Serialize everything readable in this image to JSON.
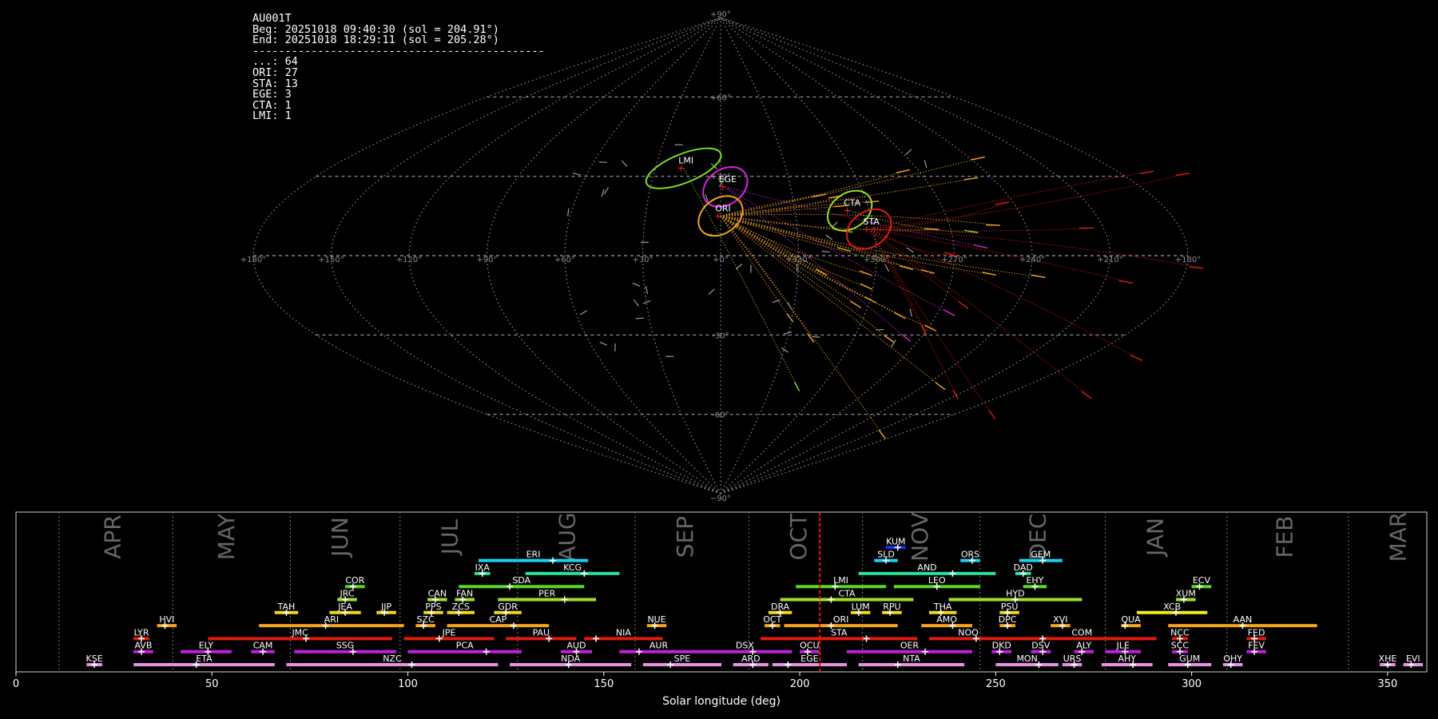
{
  "info": {
    "station": "AU001T",
    "beg": "Beg: 20251018 09:40:30 (sol = 204.91°)",
    "end": "End: 20251018 18:29:11 (sol = 205.28°)",
    "separator": "---------------------------------------------",
    "counts": [
      {
        "code": "...",
        "n": 64
      },
      {
        "code": "ORI",
        "n": 27
      },
      {
        "code": "STA",
        "n": 13
      },
      {
        "code": "EGE",
        "n": 3
      },
      {
        "code": "CTA",
        "n": 1
      },
      {
        "code": "LMI",
        "n": 1
      }
    ]
  },
  "chart_data": [
    {
      "type": "scatter",
      "title": "",
      "projection": "sinusoidal all-sky",
      "lon_ticks": [
        "+180°",
        "+150°",
        "+120°",
        "+90°",
        "+60°",
        "+30°",
        "+0°",
        "+330°",
        "+300°",
        "+270°",
        "+240°",
        "+210°",
        "+180°"
      ],
      "lat_ticks": [
        "+90°",
        "+60°",
        "+30°",
        "-30°",
        "-60°",
        "−90°"
      ],
      "grid": true,
      "radiants": [
        {
          "code": "LMI",
          "lon": 107,
          "lat": 33,
          "color": "#7cd922",
          "count": 1
        },
        {
          "code": "EGE",
          "lon": 88,
          "lat": 26,
          "color": "#dd22dd",
          "count": 3
        },
        {
          "code": "ORI",
          "lon": 90,
          "lat": 15,
          "color": "#f2a318",
          "count": 27
        },
        {
          "code": "CTA",
          "lon": 38,
          "lat": 17,
          "color": "#9ce022",
          "count": 1
        },
        {
          "code": "STA",
          "lon": 32,
          "lat": 10,
          "color": "#e01a0e",
          "count": 13
        }
      ]
    },
    {
      "type": "timeline",
      "xlabel": "Solar longitude (deg)",
      "xlim": [
        0,
        360
      ],
      "xticks": [
        "0",
        "50",
        "100",
        "150",
        "200",
        "250",
        "300",
        "350"
      ],
      "current_sol": 205.1,
      "months": [
        {
          "label": "APR",
          "sol": 25
        },
        {
          "label": "MAY",
          "sol": 54
        },
        {
          "label": "JUN",
          "sol": 83
        },
        {
          "label": "JUL",
          "sol": 111
        },
        {
          "label": "AUG",
          "sol": 141
        },
        {
          "label": "SEP",
          "sol": 171
        },
        {
          "label": "OCT",
          "sol": 200
        },
        {
          "label": "NOV",
          "sol": 231
        },
        {
          "label": "DEC",
          "sol": 261
        },
        {
          "label": "JAN",
          "sol": 291
        },
        {
          "label": "FEB",
          "sol": 324
        },
        {
          "label": "MAR",
          "sol": 353
        }
      ],
      "month_dividers": [
        11,
        40,
        70,
        98,
        128,
        158,
        187,
        216,
        246,
        278,
        309,
        340
      ],
      "showers": [
        {
          "code": "KUM",
          "row": 9,
          "start": 222,
          "end": 227,
          "peak": 225,
          "color": "#2030e8"
        },
        {
          "code": "ERI",
          "row": 8,
          "start": 118,
          "end": 146,
          "peak": 137,
          "color": "#18d0f0"
        },
        {
          "code": "SLD",
          "row": 8,
          "start": 219,
          "end": 225,
          "peak": 222,
          "color": "#18d0f0"
        },
        {
          "code": "ORS",
          "row": 8,
          "start": 241,
          "end": 246,
          "peak": 244,
          "color": "#18d0f0"
        },
        {
          "code": "GEM",
          "row": 8,
          "start": 256,
          "end": 267,
          "peak": 262,
          "color": "#18d0f0"
        },
        {
          "code": "IXA",
          "row": 7,
          "start": 117,
          "end": 121,
          "peak": 119,
          "color": "#28e09a"
        },
        {
          "code": "KCG",
          "row": 7,
          "start": 130,
          "end": 154,
          "peak": 145,
          "color": "#28e09a"
        },
        {
          "code": "AND",
          "row": 7,
          "start": 215,
          "end": 250,
          "peak": 239,
          "color": "#28e09a"
        },
        {
          "code": "DAD",
          "row": 7,
          "start": 255,
          "end": 259,
          "peak": 257,
          "color": "#28e09a"
        },
        {
          "code": "COR",
          "row": 6,
          "start": 84,
          "end": 89,
          "peak": 86,
          "color": "#58d820"
        },
        {
          "code": "SDA",
          "row": 6,
          "start": 113,
          "end": 145,
          "peak": 126,
          "color": "#58d820"
        },
        {
          "code": "LMI",
          "row": 6,
          "start": 199,
          "end": 222,
          "peak": 209,
          "color": "#58d820"
        },
        {
          "code": "LEO",
          "row": 6,
          "start": 224,
          "end": 246,
          "peak": 235,
          "color": "#58d820"
        },
        {
          "code": "EHY",
          "row": 6,
          "start": 257,
          "end": 263,
          "peak": 260,
          "color": "#58d820"
        },
        {
          "code": "ECV",
          "row": 6,
          "start": 300,
          "end": 305,
          "peak": 302,
          "color": "#58d820"
        },
        {
          "code": "JRC",
          "row": 5,
          "start": 82,
          "end": 87,
          "peak": 84,
          "color": "#a0e028"
        },
        {
          "code": "CAN",
          "row": 5,
          "start": 105,
          "end": 110,
          "peak": 107,
          "color": "#a0e028"
        },
        {
          "code": "FAN",
          "row": 5,
          "start": 112,
          "end": 117,
          "peak": 114,
          "color": "#a0e028"
        },
        {
          "code": "PER",
          "row": 5,
          "start": 123,
          "end": 148,
          "peak": 140,
          "color": "#a0e028"
        },
        {
          "code": "CTA",
          "row": 5,
          "start": 195,
          "end": 229,
          "peak": 208,
          "color": "#a0e028"
        },
        {
          "code": "HYD",
          "row": 5,
          "start": 238,
          "end": 272,
          "peak": 255,
          "color": "#a0e028"
        },
        {
          "code": "XUM",
          "row": 5,
          "start": 296,
          "end": 301,
          "peak": 298,
          "color": "#a0e028"
        },
        {
          "code": "TAH",
          "row": 4,
          "start": 66,
          "end": 72,
          "peak": 69,
          "color": "#f0d818"
        },
        {
          "code": "JEA",
          "row": 4,
          "start": 80,
          "end": 88,
          "peak": 84,
          "color": "#f0d818"
        },
        {
          "code": "JIP",
          "row": 4,
          "start": 92,
          "end": 97,
          "peak": 94,
          "color": "#f0d818"
        },
        {
          "code": "PPS",
          "row": 4,
          "start": 104,
          "end": 109,
          "peak": 106,
          "color": "#f0d818"
        },
        {
          "code": "ZCS",
          "row": 4,
          "start": 110,
          "end": 117,
          "peak": 113,
          "color": "#f0d818"
        },
        {
          "code": "GDR",
          "row": 4,
          "start": 122,
          "end": 129,
          "peak": 125,
          "color": "#f0d818"
        },
        {
          "code": "DRA",
          "row": 4,
          "start": 192,
          "end": 198,
          "peak": 195,
          "color": "#f0d818"
        },
        {
          "code": "LUM",
          "row": 4,
          "start": 213,
          "end": 218,
          "peak": 215,
          "color": "#f0d818"
        },
        {
          "code": "RPU",
          "row": 4,
          "start": 221,
          "end": 226,
          "peak": 223,
          "color": "#f0d818"
        },
        {
          "code": "THA",
          "row": 4,
          "start": 233,
          "end": 240,
          "peak": 236,
          "color": "#f0d818"
        },
        {
          "code": "PSU",
          "row": 4,
          "start": 251,
          "end": 256,
          "peak": 253,
          "color": "#f0d818"
        },
        {
          "code": "XCB",
          "row": 4,
          "start": 286,
          "end": 304,
          "peak": 296,
          "color": "#f0f018"
        },
        {
          "code": "HVI",
          "row": 3,
          "start": 36,
          "end": 41,
          "peak": 38,
          "color": "#f2a318"
        },
        {
          "code": "ARI",
          "row": 3,
          "start": 62,
          "end": 99,
          "peak": 79,
          "color": "#f2a318"
        },
        {
          "code": "SZC",
          "row": 3,
          "start": 102,
          "end": 107,
          "peak": 104,
          "color": "#f2a318"
        },
        {
          "code": "CAP",
          "row": 3,
          "start": 110,
          "end": 136,
          "peak": 127,
          "color": "#f2a318"
        },
        {
          "code": "NUE",
          "row": 3,
          "start": 161,
          "end": 166,
          "peak": 163,
          "color": "#f2a318"
        },
        {
          "code": "OCT",
          "row": 3,
          "start": 191,
          "end": 195,
          "peak": 193,
          "color": "#f2a318"
        },
        {
          "code": "ORI",
          "row": 3,
          "start": 196,
          "end": 225,
          "peak": 208,
          "color": "#f2a318"
        },
        {
          "code": "AMO",
          "row": 3,
          "start": 231,
          "end": 244,
          "peak": 239,
          "color": "#f2a318"
        },
        {
          "code": "DPC",
          "row": 3,
          "start": 251,
          "end": 255,
          "peak": 253,
          "color": "#f2a318"
        },
        {
          "code": "XVI",
          "row": 3,
          "start": 264,
          "end": 269,
          "peak": 267,
          "color": "#f2a318"
        },
        {
          "code": "QUA",
          "row": 3,
          "start": 282,
          "end": 287,
          "peak": 283,
          "color": "#f2a318"
        },
        {
          "code": "AAN",
          "row": 3,
          "start": 294,
          "end": 332,
          "peak": 313,
          "color": "#f2a318"
        },
        {
          "code": "LYR",
          "row": 2,
          "start": 30,
          "end": 34,
          "peak": 32,
          "color": "#e01a0e"
        },
        {
          "code": "JMC",
          "row": 2,
          "start": 49,
          "end": 96,
          "peak": 74,
          "color": "#e01a0e"
        },
        {
          "code": "JPE",
          "row": 2,
          "start": 99,
          "end": 122,
          "peak": 108,
          "color": "#e01a0e"
        },
        {
          "code": "PAU",
          "row": 2,
          "start": 125,
          "end": 143,
          "peak": 136,
          "color": "#e01a0e"
        },
        {
          "code": "NIA",
          "row": 2,
          "start": 145,
          "end": 165,
          "peak": 148,
          "color": "#e01a0e"
        },
        {
          "code": "STA",
          "row": 2,
          "start": 190,
          "end": 230,
          "peak": 217,
          "color": "#e01a0e"
        },
        {
          "code": "NOO",
          "row": 2,
          "start": 233,
          "end": 253,
          "peak": 245,
          "color": "#e01a0e"
        },
        {
          "code": "COM",
          "row": 2,
          "start": 253,
          "end": 291,
          "peak": 262,
          "color": "#e01a0e"
        },
        {
          "code": "NCC",
          "row": 2,
          "start": 295,
          "end": 299,
          "peak": 297,
          "color": "#e01a0e"
        },
        {
          "code": "FED",
          "row": 2,
          "start": 314,
          "end": 319,
          "peak": 316,
          "color": "#e01a0e"
        },
        {
          "code": "AVB",
          "row": 1,
          "start": 30,
          "end": 35,
          "peak": 32,
          "color": "#c020d8"
        },
        {
          "code": "ELY",
          "row": 1,
          "start": 42,
          "end": 55,
          "peak": 49,
          "color": "#c020d8"
        },
        {
          "code": "CAM",
          "row": 1,
          "start": 60,
          "end": 66,
          "peak": 63,
          "color": "#c020d8"
        },
        {
          "code": "SSG",
          "row": 1,
          "start": 71,
          "end": 97,
          "peak": 86,
          "color": "#c020d8"
        },
        {
          "code": "PCA",
          "row": 1,
          "start": 100,
          "end": 129,
          "peak": 120,
          "color": "#c020d8"
        },
        {
          "code": "AUD",
          "row": 1,
          "start": 139,
          "end": 147,
          "peak": 143,
          "color": "#c020d8"
        },
        {
          "code": "AUR",
          "row": 1,
          "start": 154,
          "end": 174,
          "peak": 159,
          "color": "#c020d8"
        },
        {
          "code": "DSX",
          "row": 1,
          "start": 174,
          "end": 198,
          "peak": 188,
          "color": "#c020d8"
        },
        {
          "code": "OCU",
          "row": 1,
          "start": 200,
          "end": 205,
          "peak": 202,
          "color": "#c020d8"
        },
        {
          "code": "OER",
          "row": 1,
          "start": 212,
          "end": 244,
          "peak": 232,
          "color": "#c020d8"
        },
        {
          "code": "DKD",
          "row": 1,
          "start": 249,
          "end": 254,
          "peak": 251,
          "color": "#c020d8"
        },
        {
          "code": "DSV",
          "row": 1,
          "start": 259,
          "end": 264,
          "peak": 262,
          "color": "#c020d8"
        },
        {
          "code": "ALY",
          "row": 1,
          "start": 270,
          "end": 275,
          "peak": 272,
          "color": "#c020d8"
        },
        {
          "code": "JLE",
          "row": 1,
          "start": 278,
          "end": 287,
          "peak": 283,
          "color": "#c020d8"
        },
        {
          "code": "SCC",
          "row": 1,
          "start": 295,
          "end": 299,
          "peak": 297,
          "color": "#c020d8"
        },
        {
          "code": "FEV",
          "row": 1,
          "start": 314,
          "end": 319,
          "peak": 316,
          "color": "#c020d8"
        },
        {
          "code": "KSE",
          "row": 0,
          "start": 18,
          "end": 22,
          "peak": 20,
          "color": "#e890e8"
        },
        {
          "code": "ETA",
          "row": 0,
          "start": 30,
          "end": 66,
          "peak": 46,
          "color": "#e890e8"
        },
        {
          "code": "NZC",
          "row": 0,
          "start": 69,
          "end": 123,
          "peak": 101,
          "color": "#e890e8"
        },
        {
          "code": "NDA",
          "row": 0,
          "start": 126,
          "end": 157,
          "peak": 141,
          "color": "#e890e8"
        },
        {
          "code": "SPE",
          "row": 0,
          "start": 160,
          "end": 180,
          "peak": 167,
          "color": "#e890e8"
        },
        {
          "code": "ARD",
          "row": 0,
          "start": 183,
          "end": 192,
          "peak": 188,
          "color": "#e890e8"
        },
        {
          "code": "EGE",
          "row": 0,
          "start": 193,
          "end": 212,
          "peak": 197,
          "color": "#e890e8"
        },
        {
          "code": "NTA",
          "row": 0,
          "start": 215,
          "end": 242,
          "peak": 225,
          "color": "#e890e8"
        },
        {
          "code": "MON",
          "row": 0,
          "start": 250,
          "end": 266,
          "peak": 261,
          "color": "#e890e8"
        },
        {
          "code": "URS",
          "row": 0,
          "start": 267,
          "end": 272,
          "peak": 270,
          "color": "#e890e8"
        },
        {
          "code": "AHY",
          "row": 0,
          "start": 277,
          "end": 290,
          "peak": 285,
          "color": "#e890e8"
        },
        {
          "code": "GUM",
          "row": 0,
          "start": 294,
          "end": 305,
          "peak": 299,
          "color": "#e890e8"
        },
        {
          "code": "OHY",
          "row": 0,
          "start": 308,
          "end": 313,
          "peak": 310,
          "color": "#e890e8"
        },
        {
          "code": "XHE",
          "row": 0,
          "start": 348,
          "end": 352,
          "peak": 350,
          "color": "#e890e8"
        },
        {
          "code": "EVI",
          "row": 0,
          "start": 354,
          "end": 359,
          "peak": 356,
          "color": "#e890e8"
        }
      ]
    }
  ]
}
